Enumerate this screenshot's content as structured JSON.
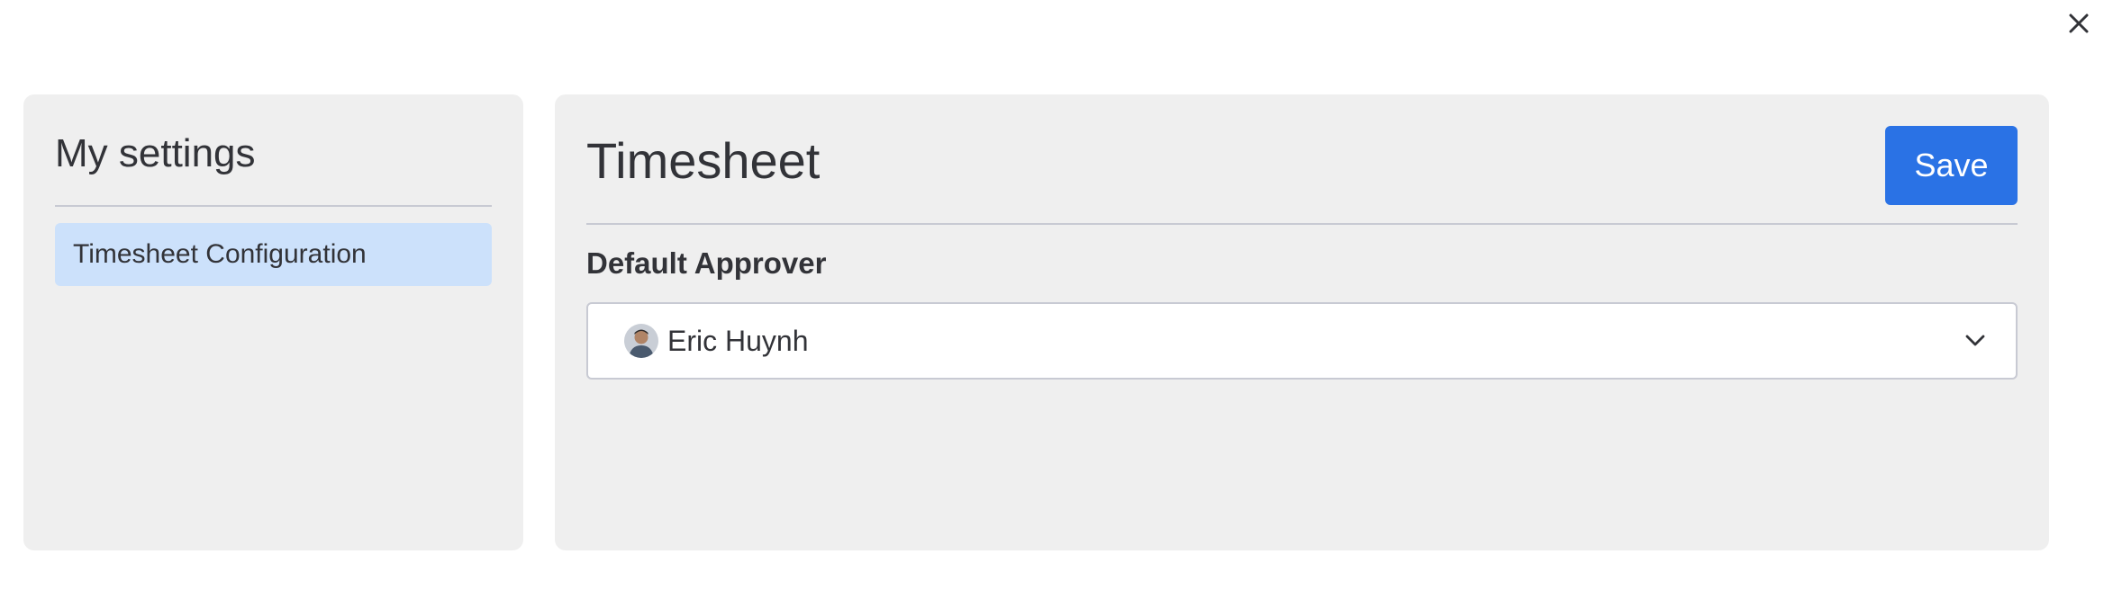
{
  "sidebar": {
    "title": "My settings",
    "items": [
      {
        "label": "Timesheet Configuration",
        "selected": true
      }
    ]
  },
  "main": {
    "title": "Timesheet",
    "save_label": "Save",
    "default_approver": {
      "label": "Default Approver",
      "value": "Eric Huynh",
      "icon": "chevron-down-icon"
    }
  },
  "colors": {
    "accent": "#2a72e5",
    "selected_item_bg": "#cce1fb",
    "panel_bg": "#efefef"
  }
}
